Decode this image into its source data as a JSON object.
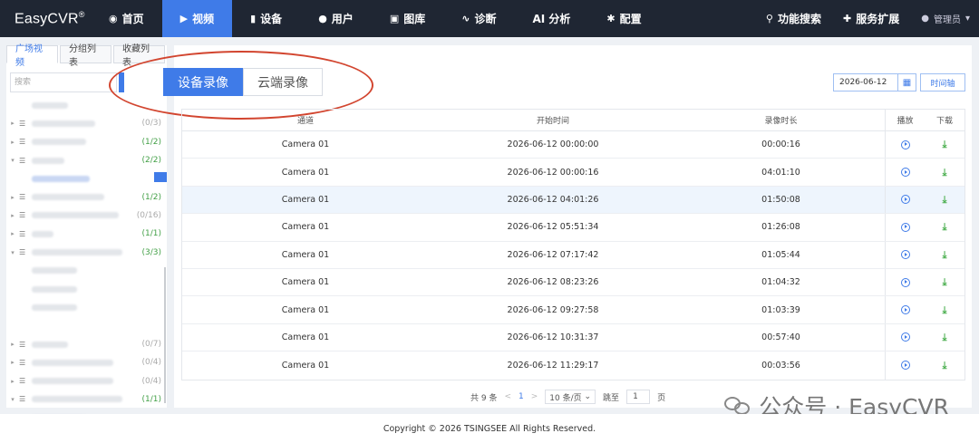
{
  "brand": {
    "name": "EasyCVR",
    "mark": "®"
  },
  "nav": {
    "items": [
      {
        "label": "首页",
        "icon": "dashboard-icon",
        "glyph": "◉"
      },
      {
        "label": "视频",
        "icon": "play-icon",
        "glyph": "▶",
        "active": true
      },
      {
        "label": "设备",
        "icon": "device-icon",
        "glyph": "▮"
      },
      {
        "label": "用户",
        "icon": "user-icon",
        "glyph": "●"
      },
      {
        "label": "图库",
        "icon": "gallery-icon",
        "glyph": "▣"
      },
      {
        "label": "诊断",
        "icon": "pulse-icon",
        "glyph": "∿"
      },
      {
        "label": "AI 分析",
        "icon": "",
        "glyph": ""
      },
      {
        "label": "配置",
        "icon": "gear-icon",
        "glyph": "✱"
      }
    ],
    "right": [
      {
        "label": "功能搜索",
        "icon": "search-icon",
        "glyph": "⚲"
      },
      {
        "label": "服务扩展",
        "icon": "puzzle-icon",
        "glyph": "✚"
      }
    ],
    "user": {
      "label": "管理员",
      "icon": "user-icon",
      "glyph": "●",
      "caret": "▾"
    }
  },
  "sidebar": {
    "tabs": [
      {
        "label": "广场视频",
        "active": true
      },
      {
        "label": "分组列表"
      },
      {
        "label": "收藏列表"
      }
    ],
    "search_placeholder": "搜索",
    "tree": [
      {
        "level": 1,
        "arrow": "",
        "count": "",
        "w": 40
      },
      {
        "level": 0,
        "arrow": "▸",
        "count": "(0/3)",
        "online": false,
        "w": 70
      },
      {
        "level": 0,
        "arrow": "▸",
        "count": "(1/2)",
        "online": true,
        "w": 60
      },
      {
        "level": 0,
        "arrow": "▾",
        "count": "(2/2)",
        "online": true,
        "w": 36
      },
      {
        "level": 1,
        "arrow": "",
        "count": "",
        "w": 64,
        "selected": true
      },
      {
        "level": 0,
        "arrow": "▸",
        "count": "(1/2)",
        "online": true,
        "w": 80
      },
      {
        "level": 0,
        "arrow": "▸",
        "count": "(0/16)",
        "online": false,
        "w": 96
      },
      {
        "level": 0,
        "arrow": "▸",
        "count": "(1/1)",
        "online": true,
        "w": 24
      },
      {
        "level": 0,
        "arrow": "▾",
        "count": "(3/3)",
        "online": true,
        "w": 100
      },
      {
        "level": 1,
        "arrow": "",
        "count": "",
        "w": 50
      },
      {
        "level": 1,
        "arrow": "",
        "count": "",
        "w": 50
      },
      {
        "level": 1,
        "arrow": "",
        "count": "",
        "w": 50
      },
      {
        "level": 1,
        "arrow": "",
        "count": "",
        "w": 0
      },
      {
        "level": 0,
        "arrow": "▸",
        "count": "(0/7)",
        "online": false,
        "w": 40
      },
      {
        "level": 0,
        "arrow": "▸",
        "count": "(0/4)",
        "online": false,
        "w": 90
      },
      {
        "level": 0,
        "arrow": "▸",
        "count": "(0/4)",
        "online": false,
        "w": 90
      },
      {
        "level": 0,
        "arrow": "▾",
        "count": "(1/1)",
        "online": true,
        "w": 100
      },
      {
        "level": 1,
        "arrow": "",
        "count": "",
        "w": 60
      }
    ]
  },
  "main": {
    "record_tabs": [
      {
        "label": "设备录像",
        "active": true
      },
      {
        "label": "云端录像"
      }
    ],
    "date_value": "2026-06-12",
    "timeline_label": "时间轴",
    "columns": [
      "通道",
      "开始时间",
      "录像时长",
      "播放",
      "下载"
    ],
    "rows": [
      {
        "channel": "Camera 01",
        "start": "2026-06-12 00:00:00",
        "duration": "00:00:16"
      },
      {
        "channel": "Camera 01",
        "start": "2026-06-12 00:00:16",
        "duration": "04:01:10"
      },
      {
        "channel": "Camera 01",
        "start": "2026-06-12 04:01:26",
        "duration": "01:50:08",
        "highlight": true
      },
      {
        "channel": "Camera 01",
        "start": "2026-06-12 05:51:34",
        "duration": "01:26:08"
      },
      {
        "channel": "Camera 01",
        "start": "2026-06-12 07:17:42",
        "duration": "01:05:44"
      },
      {
        "channel": "Camera 01",
        "start": "2026-06-12 08:23:26",
        "duration": "01:04:32"
      },
      {
        "channel": "Camera 01",
        "start": "2026-06-12 09:27:58",
        "duration": "01:03:39"
      },
      {
        "channel": "Camera 01",
        "start": "2026-06-12 10:31:37",
        "duration": "00:57:40"
      },
      {
        "channel": "Camera 01",
        "start": "2026-06-12 11:29:17",
        "duration": "00:03:56"
      }
    ],
    "pager": {
      "total": "共 9 条",
      "prev": "<",
      "page": "1",
      "next": ">",
      "size": "10 条/页",
      "jump_label": "跳至",
      "jump_value": "1",
      "page_suffix": "页"
    }
  },
  "watermark": "公众号 · EasyCVR",
  "footer": "Copyright © 2026 TSINGSEE All Rights Reserved."
}
